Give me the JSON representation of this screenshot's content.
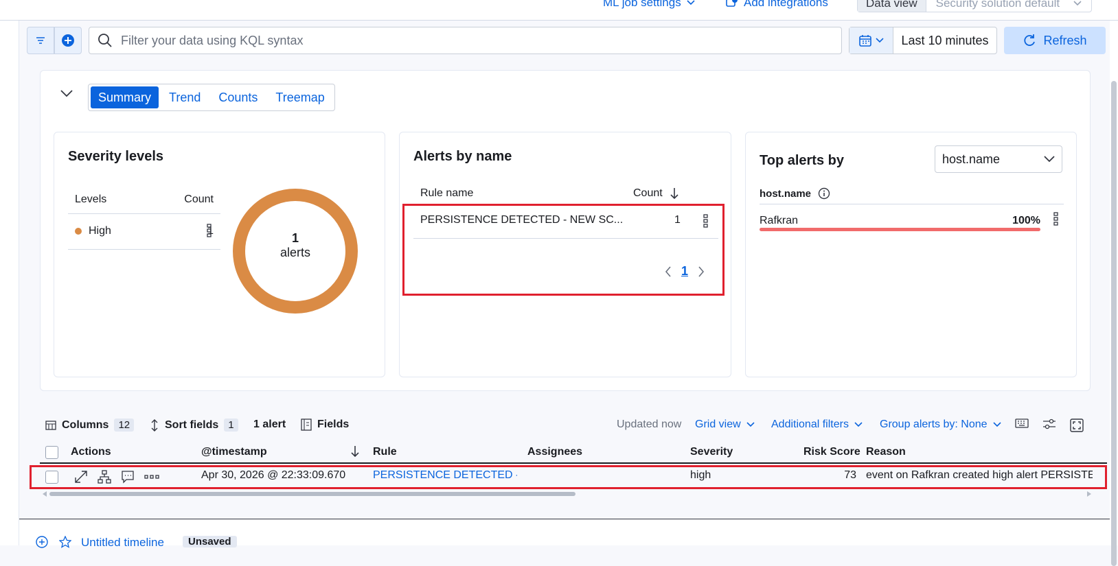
{
  "topbar": {
    "ml_job_settings": "ML job settings",
    "add_integrations": "Add integrations",
    "data_view_label": "Data view",
    "data_view_value": "Security solution default"
  },
  "query": {
    "search_placeholder": "Filter your data using KQL syntax",
    "time_range": "Last 10 minutes",
    "refresh_label": "Refresh"
  },
  "summary": {
    "tabs": [
      "Summary",
      "Trend",
      "Counts",
      "Treemap"
    ],
    "active_tab": "Summary"
  },
  "severity": {
    "title": "Severity levels",
    "col_levels": "Levels",
    "col_count": "Count",
    "rows": [
      {
        "level": "High",
        "count": "1"
      }
    ],
    "donut_count": "1",
    "donut_label": "alerts",
    "color_high": "#da8b45"
  },
  "alerts_by_name": {
    "title": "Alerts by name",
    "col_rule": "Rule name",
    "col_count": "Count",
    "rows": [
      {
        "rule": "PERSISTENCE DETECTED - NEW SC...",
        "count": "1"
      }
    ],
    "page": "1"
  },
  "top_alerts": {
    "title": "Top alerts by",
    "field_select": "host.name",
    "field_label": "host.name",
    "rows": [
      {
        "host": "Rafkran",
        "percent_label": "100%",
        "percent": 1.0
      }
    ]
  },
  "table_toolbar": {
    "columns_label": "Columns",
    "columns_count": "12",
    "sort_label": "Sort fields",
    "sort_count": "1",
    "alert_count": "1 alert",
    "fields_label": "Fields",
    "updated": "Updated now",
    "grid_view": "Grid view",
    "additional_filters": "Additional filters",
    "group_by": "Group alerts by: None"
  },
  "grid": {
    "headers": {
      "actions": "Actions",
      "timestamp": "@timestamp",
      "rule": "Rule",
      "assignees": "Assignees",
      "severity": "Severity",
      "risk_score": "Risk Score",
      "reason": "Reason"
    },
    "rows": [
      {
        "timestamp": "Apr 30, 2026 @ 22:33:09.670",
        "rule": "PERSISTENCE DETECTED -...",
        "assignees": "",
        "severity": "high",
        "risk_score": "73",
        "reason": "event on Rafkran created high alert PERSISTENCE DETECTED - NEW SCHEDULED TASK"
      }
    ]
  },
  "timeline": {
    "title": "Untitled timeline",
    "status": "Unsaved"
  }
}
